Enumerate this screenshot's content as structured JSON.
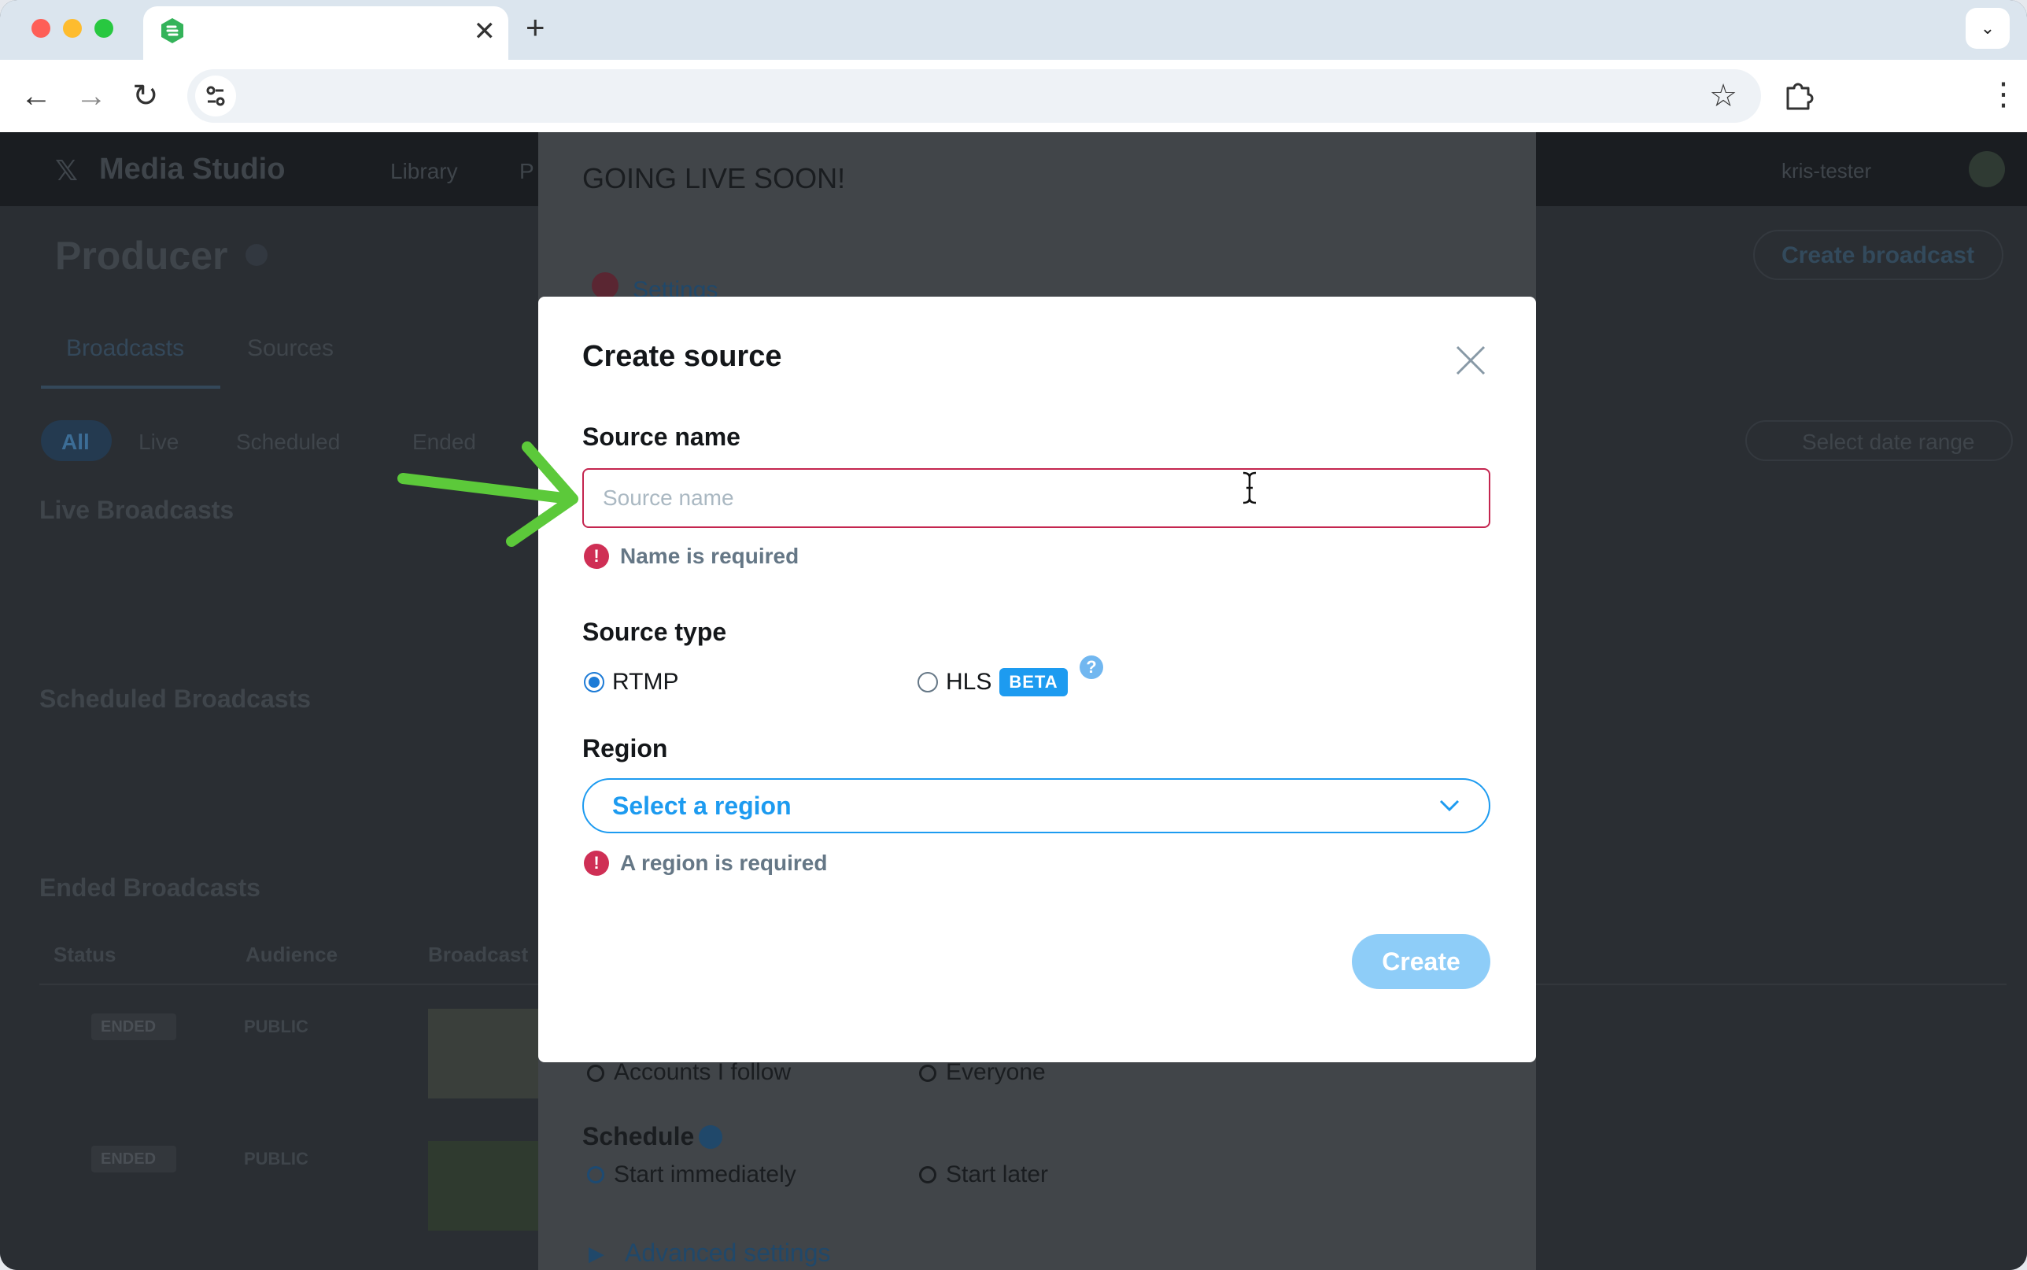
{
  "browser": {
    "tab_close": "✕",
    "new_tab": "+",
    "tab_menu": "⌄",
    "nav_back": "←",
    "nav_forward": "→",
    "nav_reload": "↻",
    "star": "☆",
    "kebab": "⋮",
    "icons": [
      "tab-favicon",
      "back-icon",
      "forward-icon",
      "reload-icon",
      "site-info-icon",
      "bookmark-star-icon",
      "extensions-icon",
      "menu-icon"
    ]
  },
  "background_page": {
    "brand": "Media Studio",
    "nav": [
      "Library",
      "P"
    ],
    "account": "kris-tester",
    "page_title": "Producer",
    "create_broadcast": "Create broadcast",
    "tabs": [
      "Broadcasts",
      "Sources"
    ],
    "filters": [
      "All",
      "Live",
      "Scheduled",
      "Ended"
    ],
    "date_range": "Select date range",
    "sections": [
      "Live Broadcasts",
      "Scheduled Broadcasts",
      "Ended Broadcasts"
    ],
    "columns": [
      "Status",
      "Audience",
      "Broadcast"
    ],
    "rows": [
      {
        "status": "ENDED",
        "audience": "PUBLIC"
      },
      {
        "status": "ENDED",
        "audience": "PUBLIC"
      }
    ]
  },
  "sheet": {
    "heading": "GOING LIVE SOON!",
    "settings_link": "Settings",
    "audience_options": [
      "Accounts I follow",
      "Everyone"
    ],
    "schedule_label": "Schedule",
    "schedule_options": [
      "Start immediately",
      "Start later"
    ],
    "advanced": "Advanced settings"
  },
  "modal": {
    "title": "Create source",
    "source_name_label": "Source name",
    "source_name_placeholder": "Source name",
    "source_name_value": "",
    "name_error": "Name is required",
    "source_type_label": "Source type",
    "types": [
      {
        "label": "RTMP",
        "selected": true
      },
      {
        "label": "HLS",
        "selected": false,
        "badge": "BETA"
      }
    ],
    "help": "?",
    "region_label": "Region",
    "region_placeholder": "Select a region",
    "region_error": "A region is required",
    "create_label": "Create"
  },
  "colors": {
    "accent": "#1d9bf0",
    "error": "#cf2f55",
    "disabled_button": "#8ecdf8",
    "annotation_arrow": "#5cc93a"
  }
}
